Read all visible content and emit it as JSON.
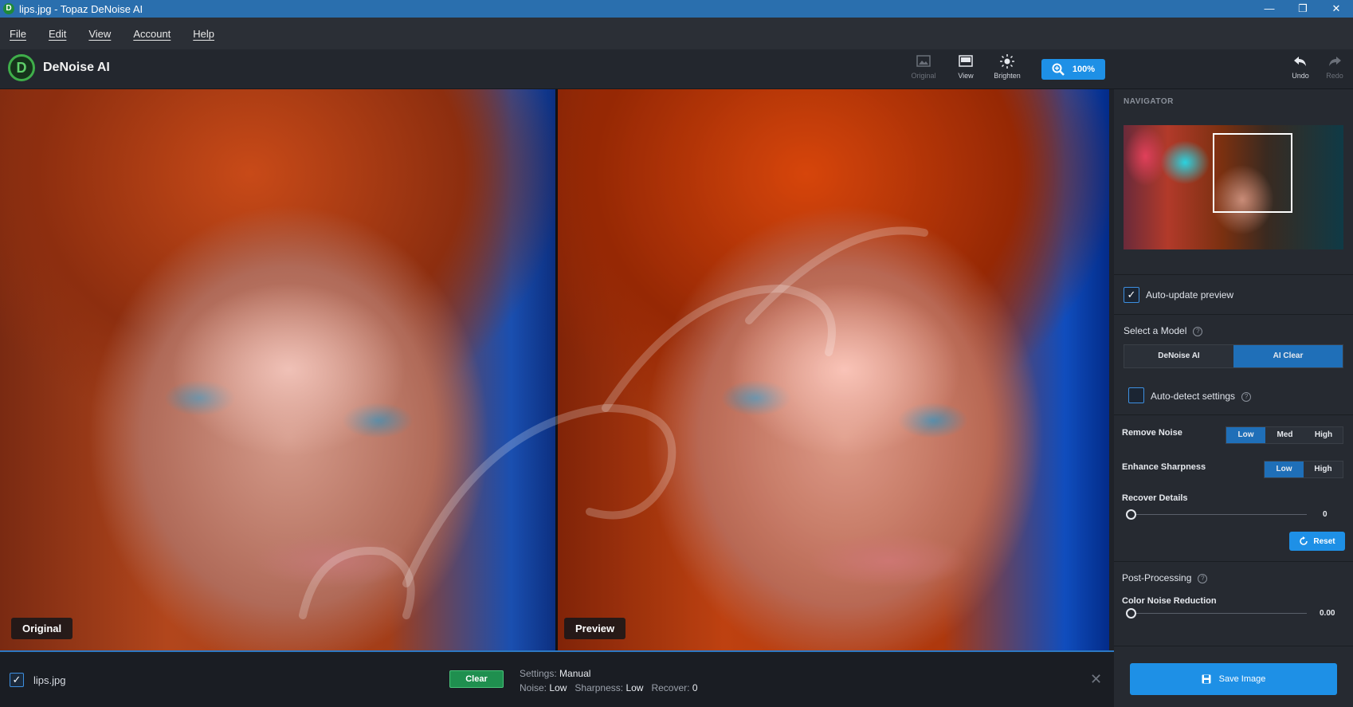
{
  "window": {
    "title": "lips.jpg - Topaz DeNoise AI",
    "minimize": "—",
    "restore": "❐",
    "close": "✕",
    "app_icon_letter": "D"
  },
  "menu": [
    "File",
    "Edit",
    "View",
    "Account",
    "Help"
  ],
  "toolbar": {
    "app_name": "DeNoise AI",
    "logo_letter": "D",
    "original_label": "Original",
    "view_label": "View",
    "brighten_label": "Brighten",
    "zoom_label": "100%",
    "undo_label": "Undo",
    "redo_label": "Redo"
  },
  "viewport": {
    "left_label": "Original",
    "right_label": "Preview"
  },
  "bottom_bar": {
    "file_checked": true,
    "file_name": "lips.jpg",
    "clear_label": "Clear",
    "settings_label": "Settings:",
    "settings_value": "Manual",
    "noise_label": "Noise:",
    "noise_value": "Low",
    "sharpness_label": "Sharpness:",
    "sharpness_value": "Low",
    "recover_label": "Recover:",
    "recover_value": "0",
    "close_icon": "✕"
  },
  "sidebar": {
    "navigator_title": "NAVIGATOR",
    "auto_update_label": "Auto-update preview",
    "auto_update_checked": true,
    "select_model_label": "Select a Model",
    "models": [
      "DeNoise AI",
      "AI Clear"
    ],
    "active_model": "AI Clear",
    "auto_detect_label": "Auto-detect settings",
    "auto_detect_checked": false,
    "remove_noise_label": "Remove Noise",
    "remove_noise_options": [
      "Low",
      "Med",
      "High"
    ],
    "remove_noise_selected": "Low",
    "enhance_sharpness_label": "Enhance Sharpness",
    "enhance_sharpness_options": [
      "Low",
      "High"
    ],
    "enhance_sharpness_selected": "Low",
    "recover_details_label": "Recover Details",
    "recover_details_value": "0",
    "reset_label": "Reset",
    "post_processing_label": "Post-Processing",
    "color_noise_label": "Color Noise Reduction",
    "color_noise_value": "0.00",
    "save_label": "Save Image"
  },
  "colors": {
    "accent_blue": "#1e90e6",
    "clear_green": "#1f8f4f",
    "titlebar": "#2a6fae"
  }
}
